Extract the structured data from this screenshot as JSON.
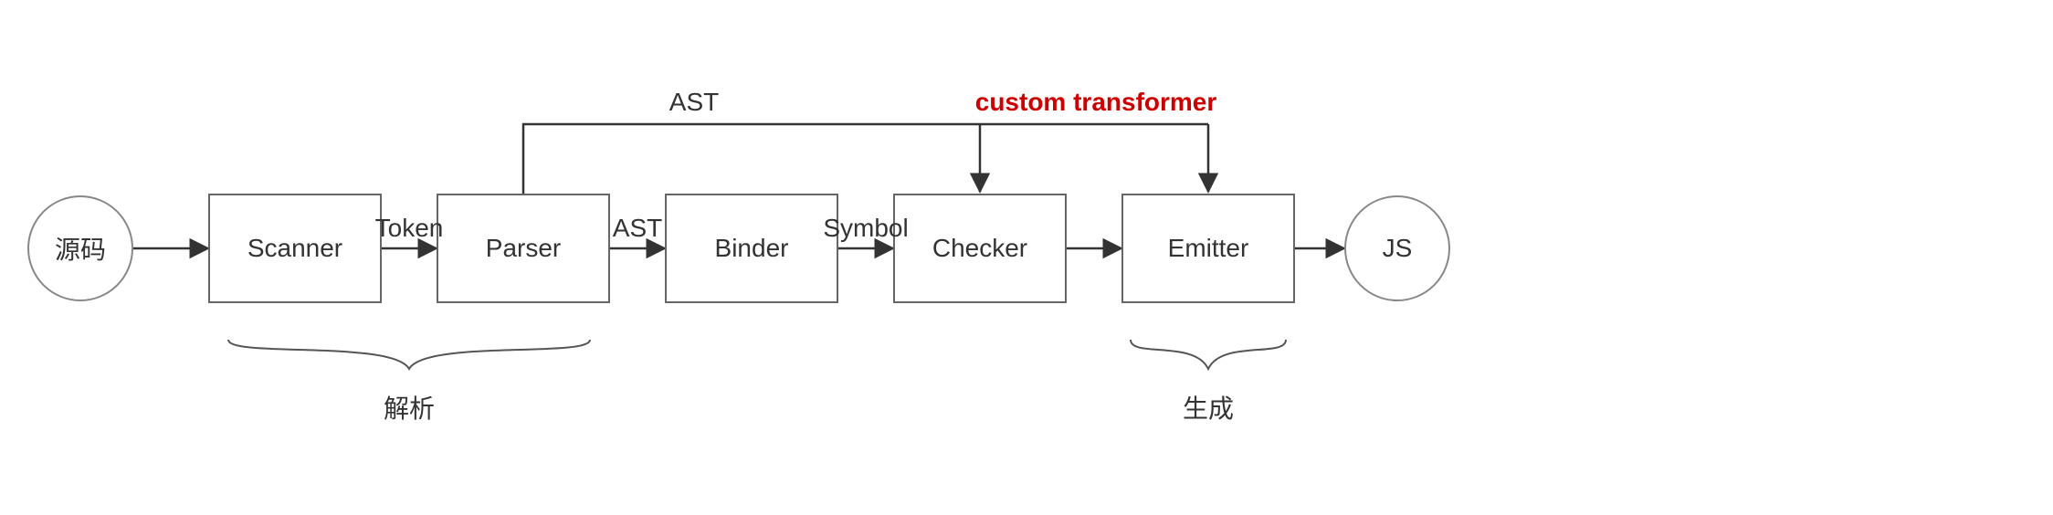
{
  "nodes": {
    "source": {
      "label": "源码"
    },
    "scanner": {
      "label": "Scanner"
    },
    "parser": {
      "label": "Parser"
    },
    "binder": {
      "label": "Binder"
    },
    "checker": {
      "label": "Checker"
    },
    "emitter": {
      "label": "Emitter"
    },
    "js": {
      "label": "JS"
    }
  },
  "edges": {
    "source_to_scanner": {
      "label": ""
    },
    "scanner_to_parser": {
      "label": "Token"
    },
    "parser_to_binder": {
      "label": "AST"
    },
    "binder_to_checker": {
      "label": "Symbol"
    },
    "checker_to_emitter": {
      "label": ""
    },
    "emitter_to_js": {
      "label": ""
    },
    "parser_to_checker_top": {
      "label": "AST"
    },
    "custom_transformer_top": {
      "label": "custom transformer"
    }
  },
  "groups": {
    "parse": {
      "label": "解析"
    },
    "emit": {
      "label": "生成"
    }
  },
  "chart_data": {
    "type": "flow-diagram",
    "title": "TypeScript compiler pipeline",
    "nodes": [
      {
        "id": "source",
        "label": "源码",
        "shape": "circle"
      },
      {
        "id": "scanner",
        "label": "Scanner",
        "shape": "rect"
      },
      {
        "id": "parser",
        "label": "Parser",
        "shape": "rect"
      },
      {
        "id": "binder",
        "label": "Binder",
        "shape": "rect"
      },
      {
        "id": "checker",
        "label": "Checker",
        "shape": "rect"
      },
      {
        "id": "emitter",
        "label": "Emitter",
        "shape": "rect"
      },
      {
        "id": "js",
        "label": "JS",
        "shape": "circle"
      }
    ],
    "edges": [
      {
        "from": "source",
        "to": "scanner",
        "label": ""
      },
      {
        "from": "scanner",
        "to": "parser",
        "label": "Token"
      },
      {
        "from": "parser",
        "to": "binder",
        "label": "AST"
      },
      {
        "from": "binder",
        "to": "checker",
        "label": "Symbol"
      },
      {
        "from": "checker",
        "to": "emitter",
        "label": ""
      },
      {
        "from": "emitter",
        "to": "js",
        "label": ""
      },
      {
        "from": "parser",
        "to": "checker",
        "label": "AST",
        "path": "top"
      },
      {
        "from": "parser",
        "to": "emitter",
        "label": "custom transformer",
        "path": "top",
        "highlight": true
      }
    ],
    "groups": [
      {
        "label": "解析",
        "members": [
          "scanner",
          "parser"
        ]
      },
      {
        "label": "生成",
        "members": [
          "emitter"
        ]
      }
    ]
  }
}
